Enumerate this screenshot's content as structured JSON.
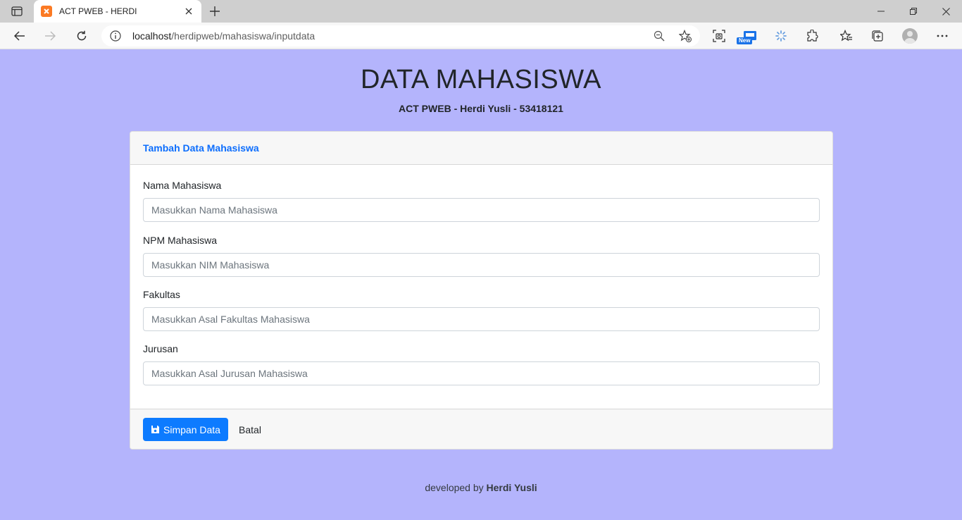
{
  "browser": {
    "tab_title": "ACT PWEB - HERDI",
    "address_host": "localhost",
    "address_path": "/herdipweb/mahasiswa/inputdata",
    "new_badge": "New"
  },
  "page": {
    "title": "DATA MAHASISWA",
    "subtitle": "ACT PWEB - Herdi Yusli - 53418121"
  },
  "card": {
    "header": "Tambah Data Mahasiswa",
    "fields": [
      {
        "label": "Nama Mahasiswa",
        "placeholder": "Masukkan Nama Mahasiswa",
        "value": ""
      },
      {
        "label": "NPM Mahasiswa",
        "placeholder": "Masukkan NIM Mahasiswa",
        "value": ""
      },
      {
        "label": "Fakultas",
        "placeholder": "Masukkan Asal Fakultas Mahasiswa",
        "value": ""
      },
      {
        "label": "Jurusan",
        "placeholder": "Masukkan Asal Jurusan Mahasiswa",
        "value": ""
      }
    ],
    "save_label": "Simpan Data",
    "cancel_label": "Batal"
  },
  "footer": {
    "prefix": "developed by",
    "author": "Herdi Yusli"
  },
  "colors": {
    "background": "#b4b4fc",
    "primary": "#0d7bff"
  }
}
